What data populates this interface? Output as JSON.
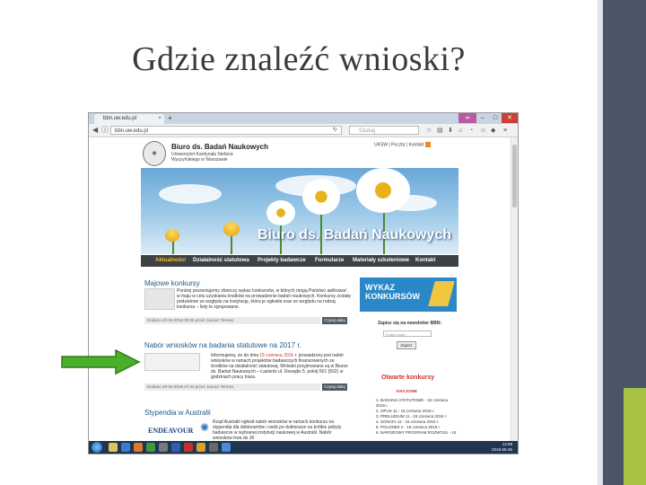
{
  "slide": {
    "title": "Gdzie znaleźć wnioski?"
  },
  "browser": {
    "tab_title": "bbn.uw.edu.pl",
    "tab_close": "×",
    "new_tab": "+",
    "url": "bbn.uw.edu.pl",
    "search_placeholder": "Szukaj",
    "win_min": "–",
    "win_max": "□",
    "win_close": "✕"
  },
  "site": {
    "org_name": "Biuro ds. Badań Naukowych",
    "org_sub": "Uniwersytet Kardynała Stefana Wyszyńskiego w Warszawie",
    "top_links": "UKSW | Poczta | Kontakt",
    "banner_text": "Biuro ds. Badań Naukowych",
    "menu": [
      "Aktualności",
      "Działalność statutowa",
      "Projekty badawcze",
      "Formularze",
      "Materiały szkoleniowe",
      "Kontakt"
    ]
  },
  "news": [
    {
      "title": "Majowe konkursy",
      "body": "Poniżej prezentujemy zbiorczy wykaz konkursów, w których mogą Państwo aplikować w maju w celu uzyskania środków na prowadzenie badań naukowych. Konkursy zostały podzielone ze względu na instytucję, która je ogłosiła oraz ze względu na rodzaj konkursu – listy te zgrupowane.",
      "meta": "Dodano 20-04-2016 09:25 przez Janusz Termes",
      "more": "Czytaj dalej"
    },
    {
      "title": "Nabór wniosków na badania statutowe na 2017 r.",
      "body_pre": "Informujemy, że do dnia ",
      "body_date": "15 czerwca 2016",
      "body_post": " r. prowadzony jest nabór wniosków w ramach projektów badawczych finansowanych ze środków na działalność statutową. Wnioski przyjmowane są w Biurze ds. Badań Naukowych – Łazienki ul. Dewajtis 5, pokój 501 (502) w godzinach pracy biura.",
      "meta": "Dodano 20-04-2016 07:44 przez Janusz Termes",
      "more": "Czytaj dalej"
    },
    {
      "title": "Stypendia w Australii",
      "body": "Rząd Australii ogłosił nabór wniosków w ramach konkursu na stypendia dla doktorantów i osób po doktoracie na krótkie pobyty badawcze w wybranej instytucji naukowej w Australii. Nabór wniosków trwa do 30",
      "logo_text": "ENDEAVOUR"
    }
  ],
  "sidebar": {
    "banner_line1": "WYKAZ",
    "banner_line2": "KONKURSÓW",
    "newsletter_label": "Zapisz się na newsletter BBN:",
    "email_placeholder": "Podaj email...",
    "subscribe_btn": "Zapisz",
    "open_title": "Otwarte konkursy",
    "open_sub": "KRAJOWE",
    "open_items": [
      "1. BADANIA STATUTOWE - 15 czerwca 2016 r.",
      "2. OPUS 11 - 15 czerwca 2016 r.",
      "3. PRELUDIUM 11 - 15 czerwca 2016 r.",
      "4. SONATA 11 - 15 czerwca 2016 r.",
      "5. POLONEZ 2 - 15 czerwca 2016 r.",
      "6. NARODOWY PROGRAM ROZWOJU - 16"
    ]
  },
  "taskbar": {
    "time": "14:08",
    "date": "2016-05-25"
  },
  "colors": {
    "arrow": "#4caf2b",
    "menu_bg": "#3d4246",
    "accent": "#2a88c9"
  }
}
